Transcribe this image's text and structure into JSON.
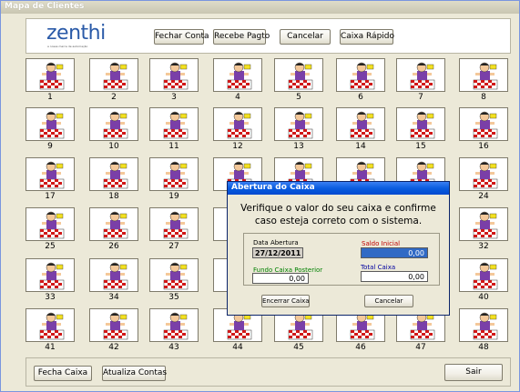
{
  "window": {
    "title": "Mapa de Clientes"
  },
  "toolbar": {
    "logo_text": "zenthi",
    "logo_tagline": "a nossa marca de automação",
    "fechar_conta": "Fechar Conta",
    "recebe_pagto": "Recebe Pagto",
    "cancelar": "Cancelar",
    "caixa_rapido": "Caixa Rápido"
  },
  "clients": [
    "1",
    "2",
    "3",
    "4",
    "5",
    "6",
    "7",
    "8",
    "9",
    "10",
    "11",
    "12",
    "13",
    "14",
    "15",
    "16",
    "17",
    "18",
    "19",
    "",
    "",
    "",
    "",
    "24",
    "25",
    "26",
    "27",
    "",
    "",
    "",
    "",
    "32",
    "33",
    "34",
    "35",
    "",
    "",
    "",
    "",
    "40",
    "41",
    "42",
    "43",
    "44",
    "45",
    "46",
    "47",
    "48"
  ],
  "footer": {
    "fecha_caixa": "Fecha Caixa",
    "atualiza_contas": "Atualiza Contas",
    "sair": "Sair"
  },
  "dialog": {
    "title": "Abertura do Caixa",
    "message_line1": "Verifique o valor do seu caixa e confirme",
    "message_line2": "caso esteja correto com o sistema.",
    "data_abertura_label": "Data Abertura",
    "data_abertura_value": "27/12/2011",
    "saldo_inicial_label": "Saldo Inicial",
    "saldo_inicial_value": "0,00",
    "fundo_caixa_label": "Fundo Caixa Posterior",
    "fundo_caixa_value": "0,00",
    "total_caixa_label": "Total Caixa",
    "total_caixa_value": "0,00",
    "encerrar_caixa": "Encerrar Caixa",
    "cancelar": "Cancelar"
  },
  "colors": {
    "saldo_label": "#c00000",
    "fundo_label": "#008000",
    "total_label": "#0000a0"
  }
}
